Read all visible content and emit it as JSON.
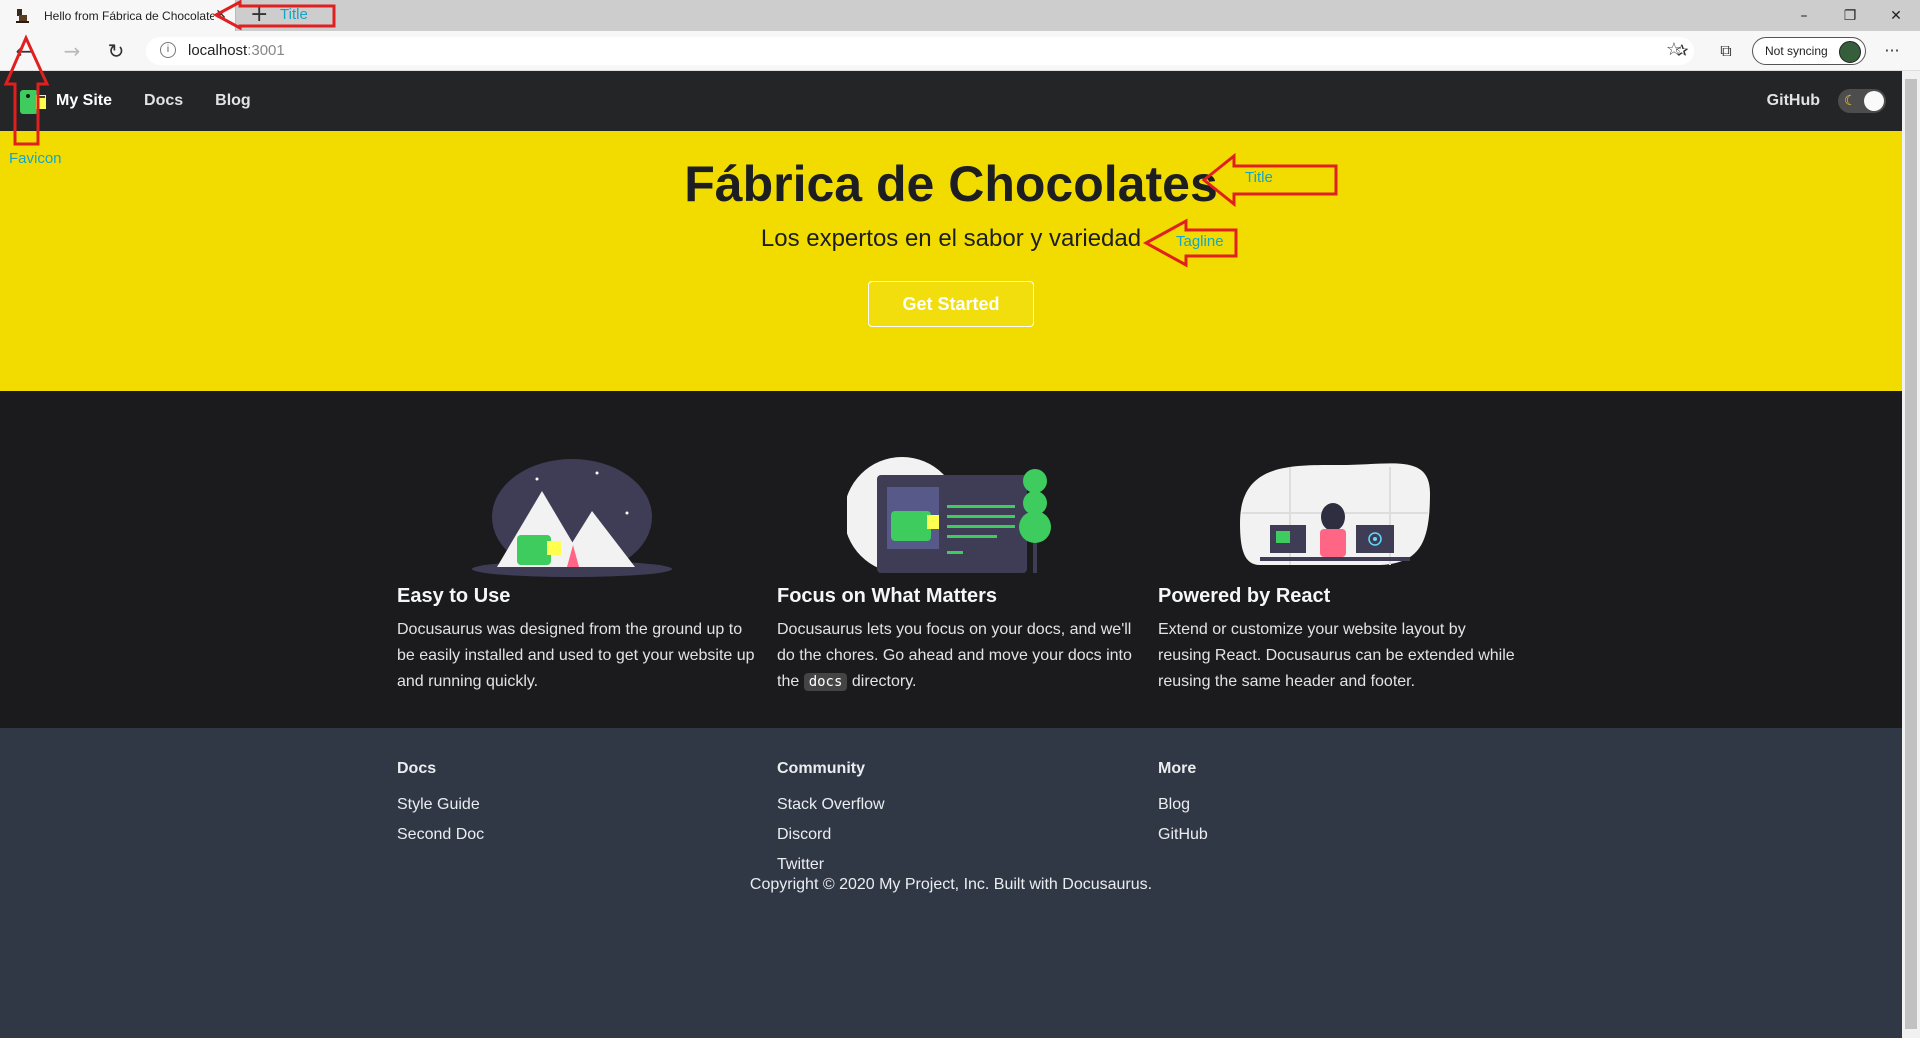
{
  "browser": {
    "tab_title": "Hello from Fábrica de Chocolate",
    "new_tab_glyph": "+",
    "url_host": "localhost",
    "url_port": ":3001",
    "sync_label": "Not syncing",
    "window_controls": [
      "–",
      "❐",
      "✕"
    ],
    "more_glyph": "···"
  },
  "navbar": {
    "brand": "My Site",
    "links": [
      "Docs",
      "Blog"
    ],
    "github": "GitHub"
  },
  "hero": {
    "title": "Fábrica de Chocolates",
    "tagline": "Los expertos en el sabor y variedad",
    "button": "Get Started",
    "background": "#f2dc00"
  },
  "features": [
    {
      "title": "Easy to Use",
      "desc": "Docusaurus was designed from the ground up to be easily installed and used to get your website up and running quickly."
    },
    {
      "title": "Focus on What Matters",
      "desc_before": "Docusaurus lets you focus on your docs, and we'll do the chores. Go ahead and move your docs into the",
      "code": "docs",
      "desc_after": "directory."
    },
    {
      "title": "Powered by React",
      "desc": "Extend or customize your website layout by reusing React. Docusaurus can be extended while reusing the same header and footer."
    }
  ],
  "footer": {
    "columns": [
      {
        "title": "Docs",
        "links": [
          "Style Guide",
          "Second Doc"
        ]
      },
      {
        "title": "Community",
        "links": [
          "Stack Overflow",
          "Discord",
          "Twitter"
        ]
      },
      {
        "title": "More",
        "links": [
          "Blog",
          "GitHub"
        ]
      }
    ],
    "copyright": "Copyright © 2020 My Project, Inc. Built with Docusaurus."
  },
  "annotations": {
    "favicon": "Favicon",
    "tab_title": "Title",
    "hero_title": "Title",
    "tagline": "Tagline",
    "color": "#e02020"
  }
}
